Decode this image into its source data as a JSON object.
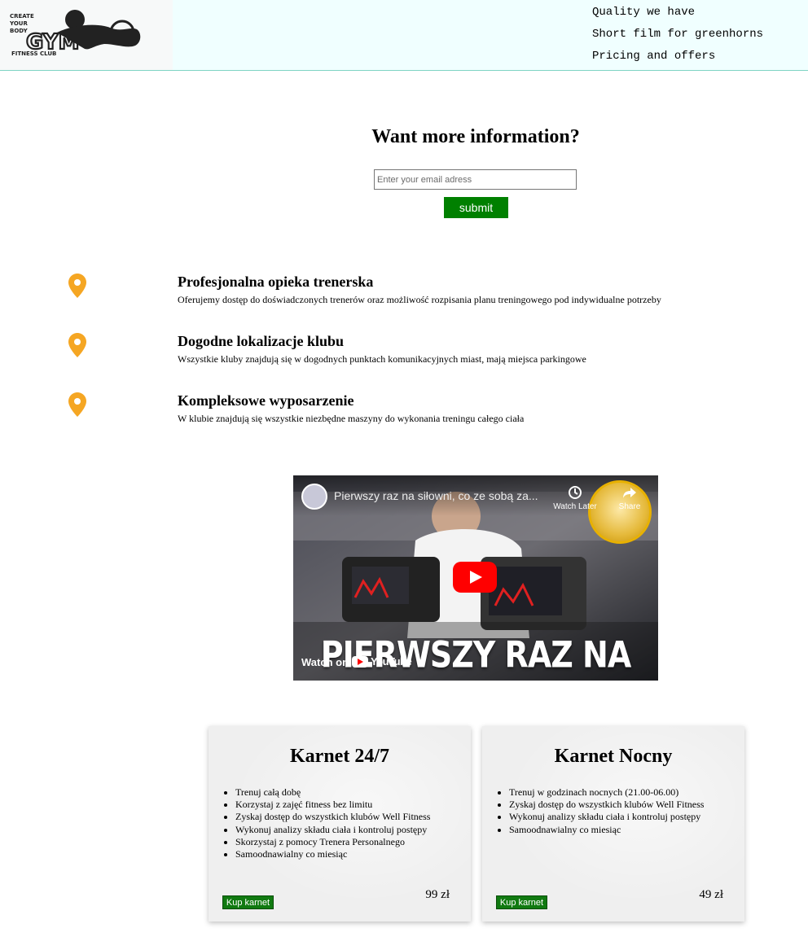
{
  "header": {
    "logo": {
      "line1": "CREATE",
      "line2": "YOUR",
      "line3": "BODY",
      "brand": "GYM",
      "tagline": "FITNESS CLUB"
    },
    "nav": [
      {
        "label": "Quality we have"
      },
      {
        "label": "Short film for greenhorns"
      },
      {
        "label": "Pricing and offers"
      }
    ]
  },
  "newsletter": {
    "title": "Want more information?",
    "email_placeholder": "Enter your email adress",
    "submit_label": "submit"
  },
  "features": [
    {
      "icon": "map-pin-icon",
      "title": "Profesjonalna opieka trenerska",
      "description": "Oferujemy dostęp do doświadczonych trenerów oraz możliwość rozpisania planu treningowego pod indywidualne potrzeby"
    },
    {
      "icon": "map-pin-icon",
      "title": "Dogodne lokalizacje klubu",
      "description": "Wszystkie kluby znajdują się w dogodnych punktach komunikacyjnych miast, mają miejsca parkingowe"
    },
    {
      "icon": "map-pin-icon",
      "title": "Kompleksowe wyposarzenie",
      "description": "W klubie znajdują się wszystkie niezbędne maszyny do wykonania treningu całego ciała"
    }
  ],
  "video": {
    "title": "Pierwszy raz na siłowni, co ze sobą za...",
    "watch_later": "Watch Later",
    "share": "Share",
    "watch_on": "Watch on",
    "youtube": "YouTube",
    "overlay": "PIERWSZY RAZ NA SIŁOWNI"
  },
  "pricing": [
    {
      "title": "Karnet 24/7",
      "features": [
        "Trenuj całą dobę",
        "Korzystaj z zajęć fitness bez limitu",
        "Zyskaj dostęp do wszystkich klubów Well Fitness",
        "Wykonuj analizy składu ciała i kontroluj postępy",
        "Skorzystaj z pomocy Trenera Personalnego",
        "Samoodnawialny co miesiąc"
      ],
      "button": "Kup karnet",
      "price": "99 zł"
    },
    {
      "title": "Karnet Nocny",
      "features": [
        "Trenuj w godzinach nocnych (21.00-06.00)",
        "Zyskaj dostęp do wszystkich klubów Well Fitness",
        "Wykonuj analizy składu ciała i kontroluj postępy",
        "Samoodnawialny co miesiąc"
      ],
      "button": "Kup karnet",
      "price": "49 zł"
    }
  ],
  "colors": {
    "header_bg": "#f0ffff",
    "accent_green": "#008000",
    "pin_orange": "#f5a623",
    "youtube_red": "#ff0000"
  }
}
